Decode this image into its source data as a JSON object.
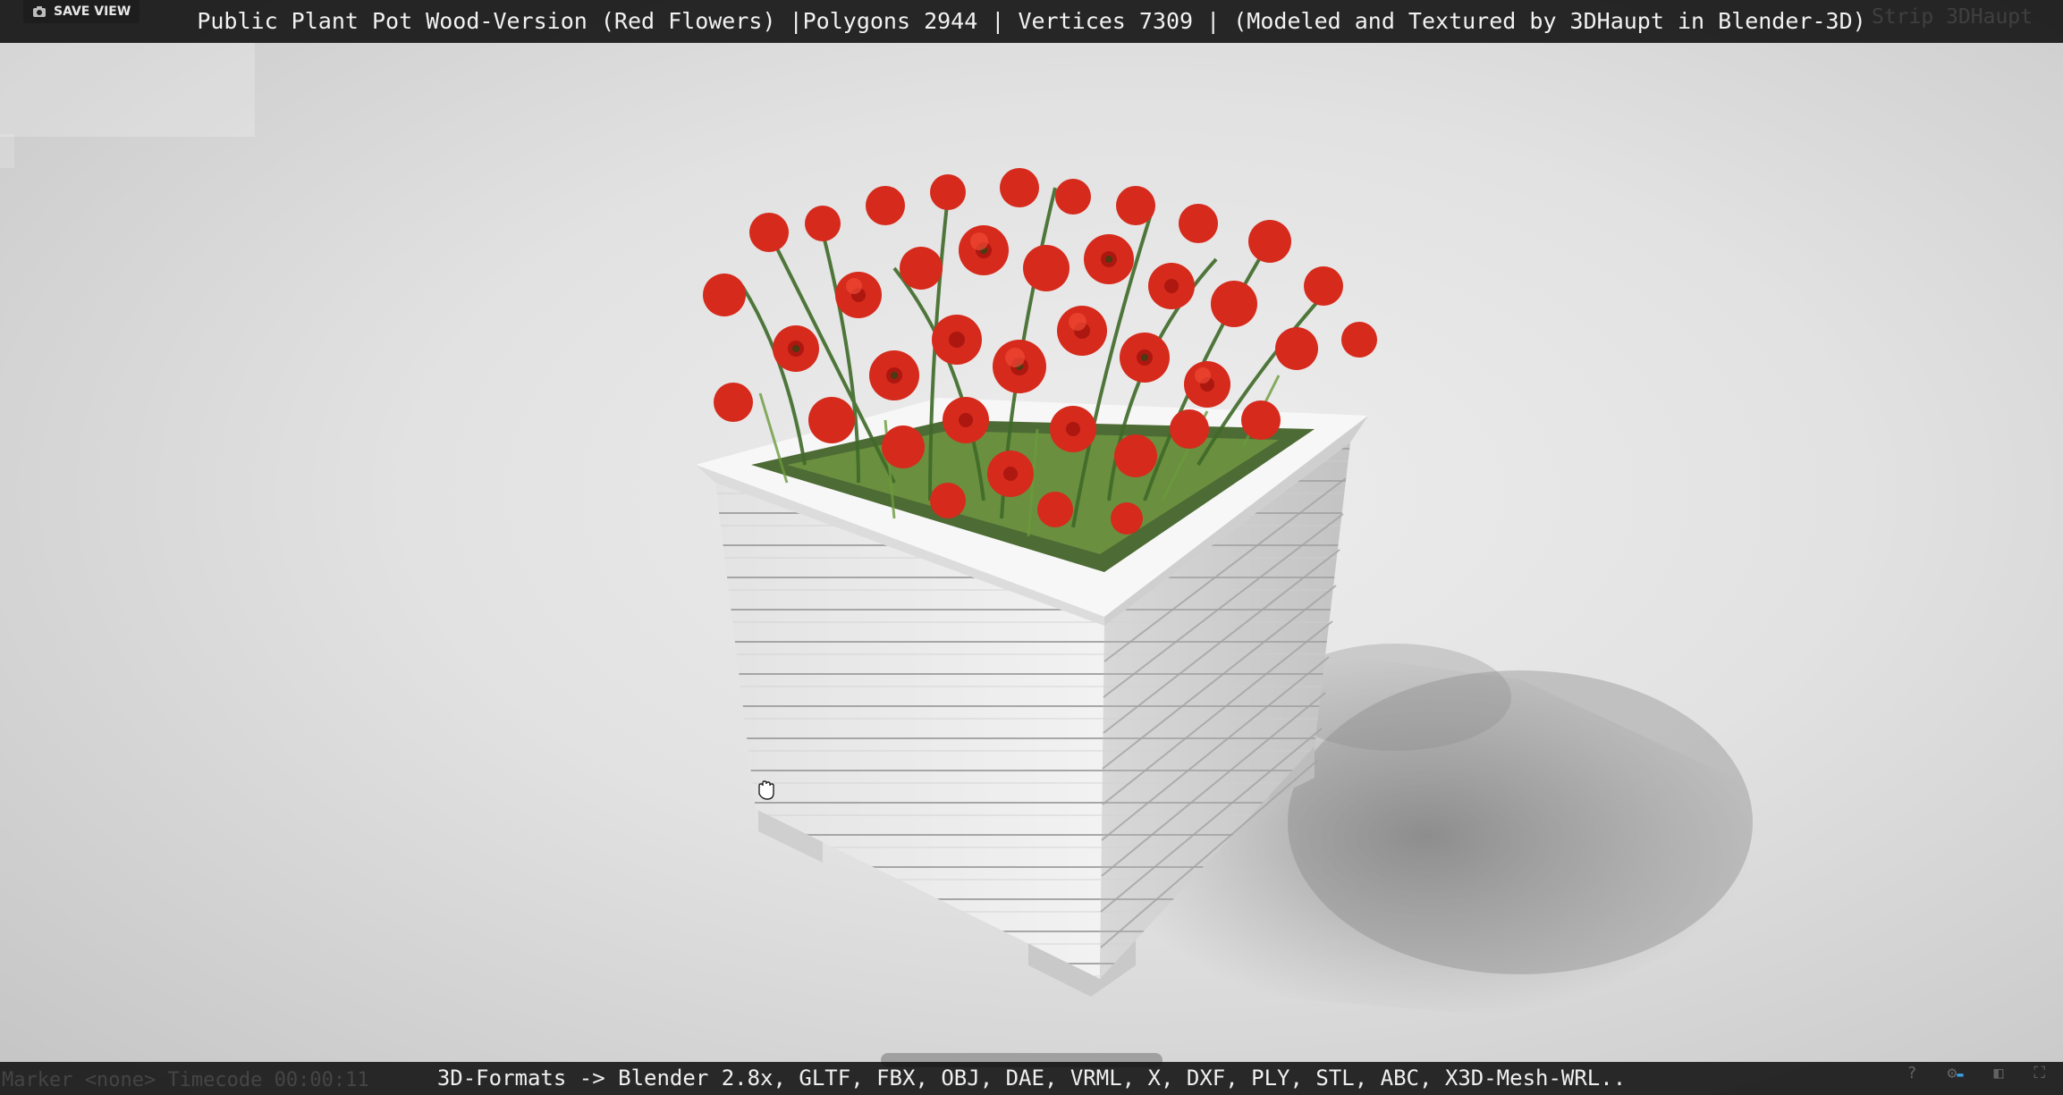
{
  "viewer": {
    "title": "Public Plant Pot Wood-Version (Red Flowers) |Polygons 2944 | Vertices 7309 | (Modeled and Textured by 3DHaupt in Blender-3D)",
    "save_view_label": "SAVE VIEW",
    "formats_caption": "3D-Formats -> Blender 2.8x, GLTF, FBX, OBJ, DAE, VRML, X, DXF, PLY, STL, ABC, X3D-Mesh-WRL..",
    "ghost_top_right": "Strip 3DHaupt",
    "ghost_bottom_left": "Marker <none>  Timecode 00:00:11"
  },
  "icons": {
    "camera": "camera-icon",
    "cursor": "hand-grab-cursor-icon",
    "help": "help-icon",
    "settings": "gear-icon",
    "vr": "vr-headset-icon",
    "fullscreen": "fullscreen-icon",
    "hd": "hd-badge-icon"
  },
  "colors": {
    "flower_red": "#d8281c",
    "pot_white": "#f0f0f0",
    "bar_bg": "#0c0c0c",
    "hd_accent": "#3aa0e8"
  },
  "scene": {
    "object": "wooden planter box with red flowers"
  }
}
